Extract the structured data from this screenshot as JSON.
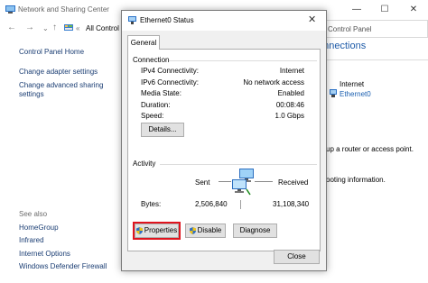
{
  "background_window": {
    "title": "Network and Sharing Center",
    "controls": {
      "minimize": "—",
      "maximize": "☐",
      "close": "✕"
    },
    "address": {
      "crumb": "All Control",
      "right_text": "Control Panel"
    },
    "sidebar": {
      "home": "Control Panel Home",
      "links": [
        "Change adapter settings",
        "Change advanced sharing",
        "settings"
      ],
      "see_also_label": "See also",
      "see_also": [
        "HomeGroup",
        "Infrared",
        "Internet Options",
        "Windows Defender Firewall"
      ]
    },
    "main": {
      "heading_fragment": "onnections",
      "internet_label": "Internet",
      "adapter_link": "Ethernet0",
      "text_router": "up a router or access point.",
      "text_troubleshoot": "ooting information."
    }
  },
  "dialog": {
    "title": "Ethernet0 Status",
    "close_glyph": "✕",
    "tab": "General",
    "connection_group": "Connection",
    "rows": [
      {
        "label": "IPv4 Connectivity:",
        "value": "Internet"
      },
      {
        "label": "IPv6 Connectivity:",
        "value": "No network access"
      },
      {
        "label": "Media State:",
        "value": "Enabled"
      },
      {
        "label": "Duration:",
        "value": "00:08:46"
      },
      {
        "label": "Speed:",
        "value": "1.0 Gbps"
      }
    ],
    "details_button": "Details...",
    "activity_group": "Activity",
    "sent_label": "Sent",
    "received_label": "Received",
    "bytes_label": "Bytes:",
    "bytes_sent": "2,506,840",
    "bytes_received": "31,108,340",
    "buttons": {
      "properties": "Properties",
      "disable": "Disable",
      "diagnose": "Diagnose",
      "close": "Close"
    },
    "highlight_color": "#e0141e"
  }
}
